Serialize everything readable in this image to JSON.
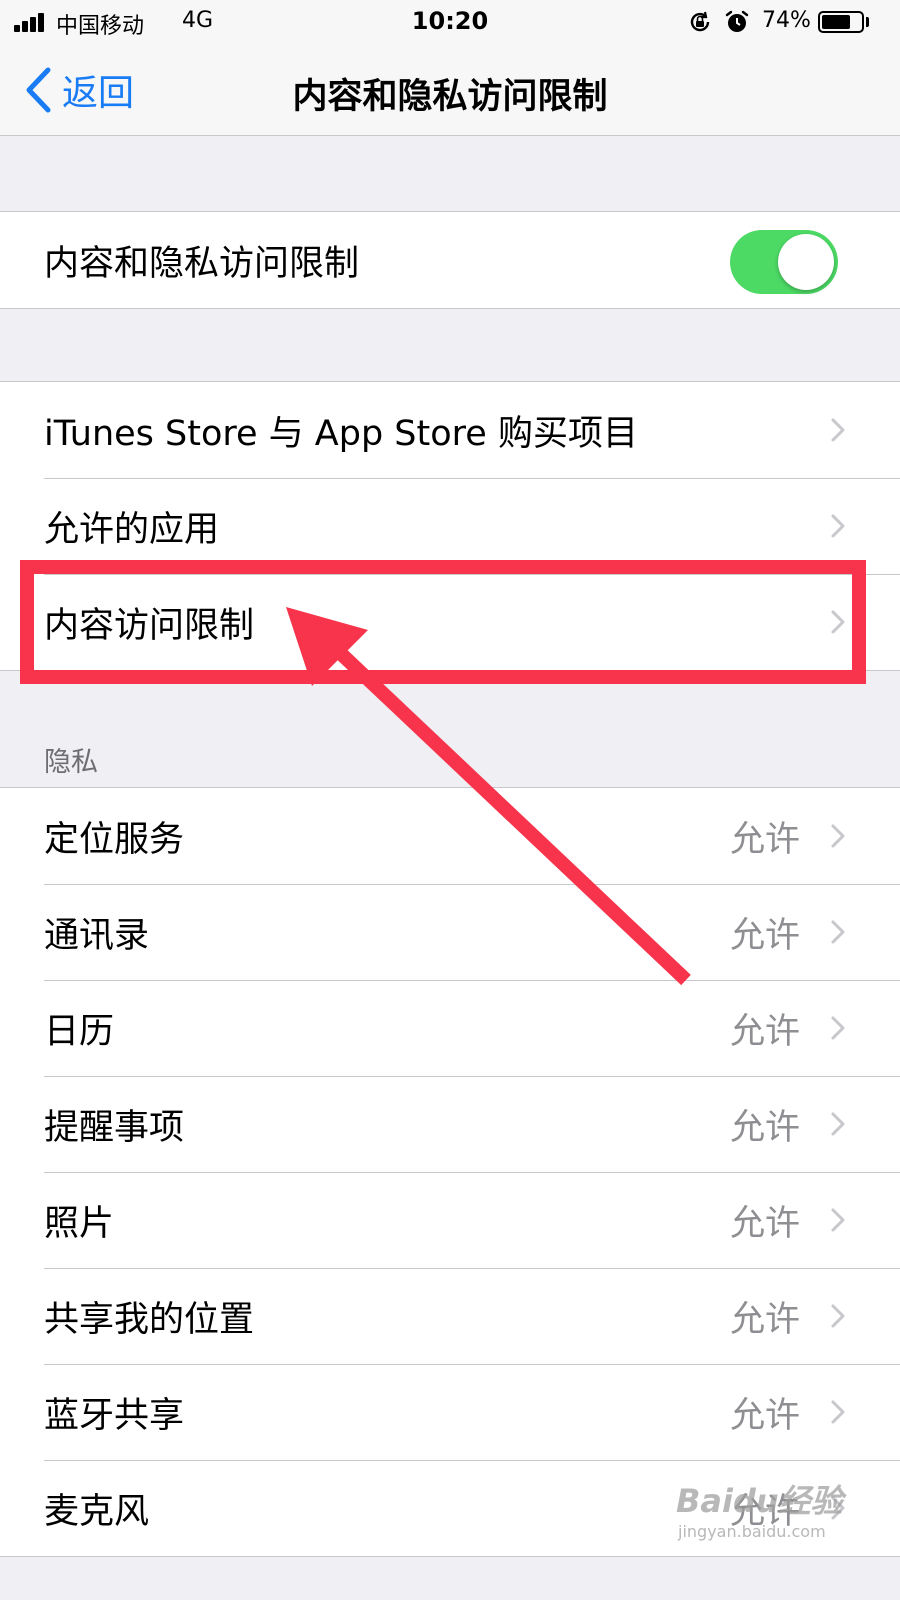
{
  "status_bar": {
    "carrier": "中国移动",
    "network": "4G",
    "time": "10:20",
    "battery_percent": "74%",
    "battery_level": 0.74,
    "icons": [
      "signal-icon",
      "orientation-lock-icon",
      "alarm-icon",
      "battery-icon"
    ]
  },
  "nav": {
    "back_label": "返回",
    "title": "内容和隐私访问限制"
  },
  "toggle_row": {
    "label": "内容和隐私访问限制",
    "enabled": true,
    "toggle_color": "#4cd964"
  },
  "restrictions": {
    "items": [
      {
        "label": "iTunes Store 与 App Store 购买项目"
      },
      {
        "label": "允许的应用"
      },
      {
        "label": "内容访问限制"
      }
    ]
  },
  "privacy": {
    "header": "隐私",
    "items": [
      {
        "label": "定位服务",
        "value": "允许"
      },
      {
        "label": "通讯录",
        "value": "允许"
      },
      {
        "label": "日历",
        "value": "允许"
      },
      {
        "label": "提醒事项",
        "value": "允许"
      },
      {
        "label": "照片",
        "value": "允许"
      },
      {
        "label": "共享我的位置",
        "value": "允许"
      },
      {
        "label": "蓝牙共享",
        "value": "允许"
      },
      {
        "label": "麦克风",
        "value": "允许"
      }
    ]
  },
  "annotation": {
    "color": "#f7344b",
    "target": "内容访问限制"
  },
  "watermark": {
    "brand": "Baidu经验",
    "url": "jingyan.baidu.com"
  },
  "colors": {
    "accent": "#1a7cf5",
    "background": "#efeff4",
    "secondary_text": "#8e8e93"
  }
}
